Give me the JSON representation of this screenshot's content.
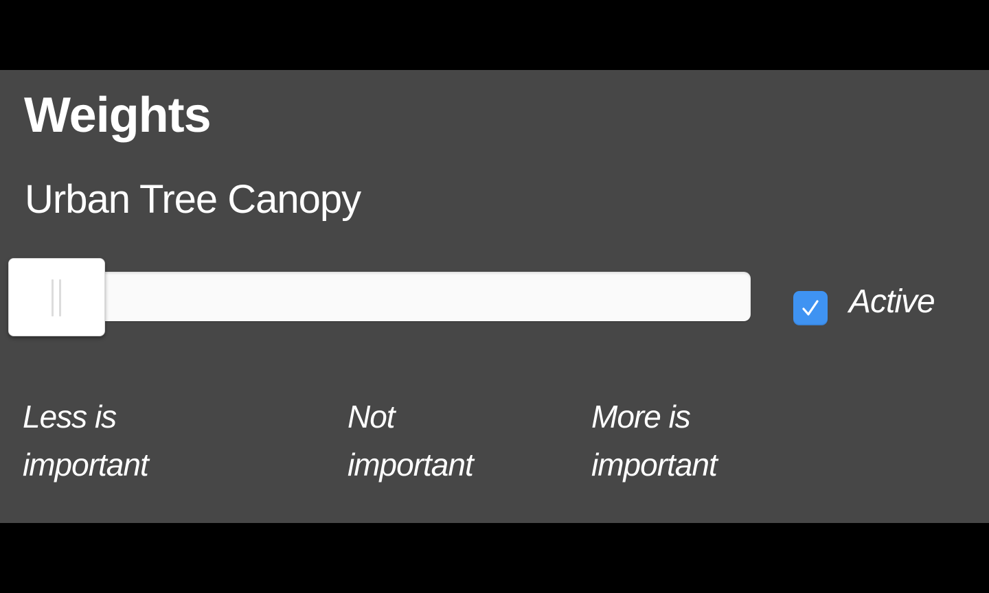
{
  "panel": {
    "title": "Weights",
    "layer_name": "Urban Tree Canopy"
  },
  "slider": {
    "value_position": "minimum"
  },
  "active_toggle": {
    "label": "Active",
    "checked": true,
    "color": "#3f93f2"
  },
  "scale_labels": {
    "left": {
      "line1": "Less is",
      "line2": "important"
    },
    "middle": {
      "line1": "Not",
      "line2": "important"
    },
    "right": {
      "line1": "More is",
      "line2": "important"
    }
  },
  "colors": {
    "panel_background": "#474747",
    "text": "#ffffff",
    "slider": "#fafafa"
  },
  "icons": {
    "checkbox": "checkmark-icon",
    "handle": "grip-icon"
  }
}
